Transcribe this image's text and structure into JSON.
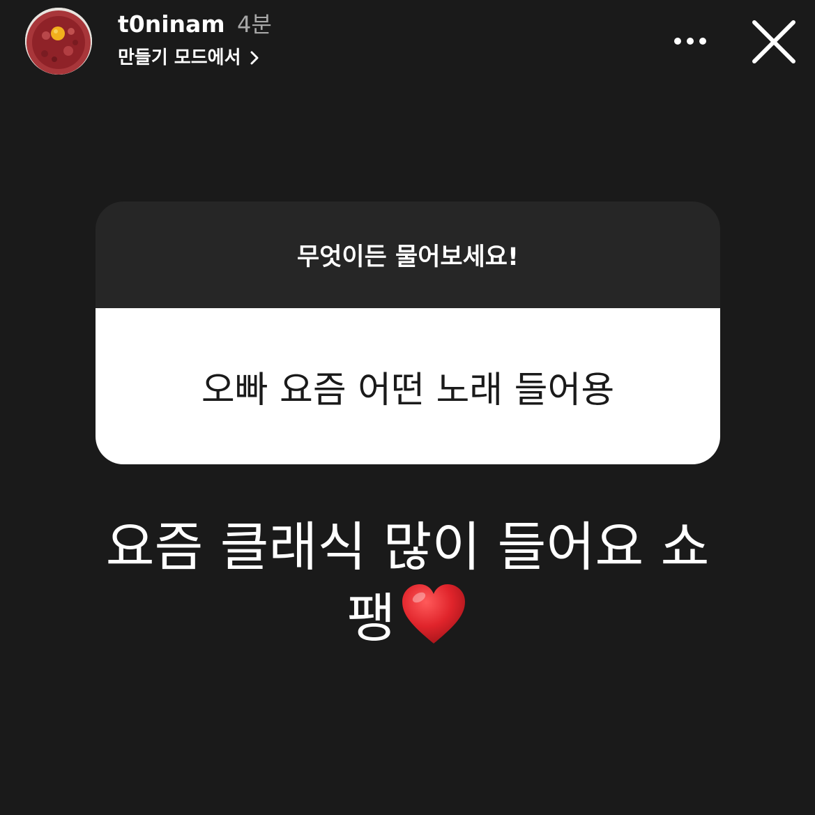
{
  "header": {
    "username": "t0ninam",
    "time_ago": "4분",
    "subtitle": "만들기 모드에서",
    "avatar_icon": "profile-food-photo",
    "more_icon": "more-dots-icon",
    "close_icon": "close-icon"
  },
  "question_sticker": {
    "prompt": "무엇이든 물어보세요!",
    "question": "오빠 요즘 어떤 노래 들어용"
  },
  "reply": {
    "line1": "요즘 클래식 많이 들어요 쇼",
    "line2": "팽",
    "emoji": "heart-icon"
  },
  "colors": {
    "background": "#1a1a1a",
    "sticker_top": "#262626",
    "sticker_bottom": "#ffffff",
    "heart": "#e0242b",
    "muted_text": "#a8a8a8"
  }
}
